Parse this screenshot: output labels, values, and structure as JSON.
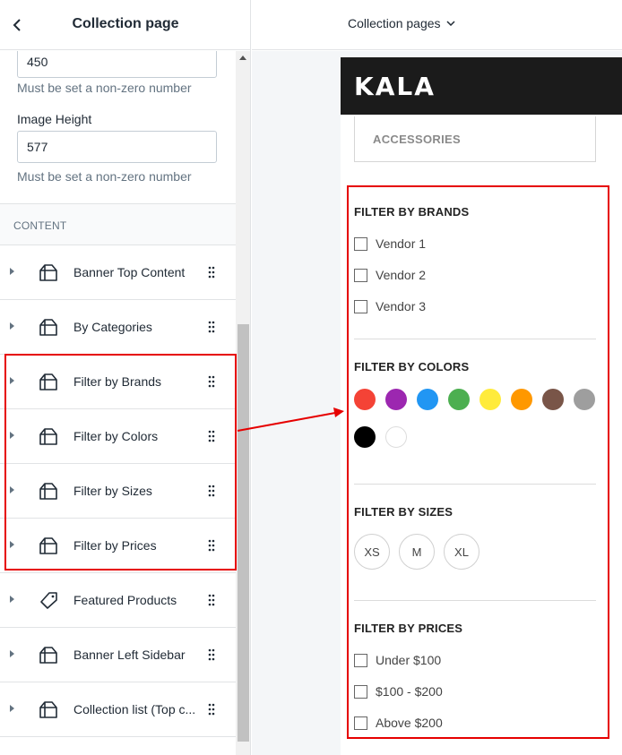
{
  "left_panel": {
    "title": "Collection page",
    "image_width_value": "450",
    "image_width_help": "Must be set a non-zero number",
    "image_height_label": "Image Height",
    "image_height_value": "577",
    "image_height_help": "Must be set a non-zero number",
    "content_section_label": "CONTENT",
    "items": [
      {
        "label": "Banner Top Content",
        "icon": "section-icon"
      },
      {
        "label": "By Categories",
        "icon": "section-icon"
      },
      {
        "label": "Filter by Brands",
        "icon": "section-icon"
      },
      {
        "label": "Filter by Colors",
        "icon": "section-icon"
      },
      {
        "label": "Filter by Sizes",
        "icon": "section-icon"
      },
      {
        "label": "Filter by Prices",
        "icon": "section-icon"
      },
      {
        "label": "Featured Products",
        "icon": "tag-icon"
      },
      {
        "label": "Banner Left Sidebar",
        "icon": "section-icon"
      },
      {
        "label": "Collection list (Top c...",
        "icon": "section-icon"
      }
    ]
  },
  "preview": {
    "page_selector": "Collection pages",
    "logo": "KALA",
    "accessories": "ACCESSORIES",
    "brands": {
      "title": "FILTER BY BRANDS",
      "options": [
        "Vendor 1",
        "Vendor 2",
        "Vendor 3"
      ]
    },
    "colors": {
      "title": "FILTER BY COLORS",
      "swatches": [
        "#f44336",
        "#9c27b0",
        "#2196f3",
        "#4caf50",
        "#ffeb3b",
        "#ff9800",
        "#795548",
        "#9e9e9e",
        "#000000",
        "#ffffff"
      ]
    },
    "sizes": {
      "title": "FILTER BY SIZES",
      "options": [
        "XS",
        "M",
        "XL"
      ]
    },
    "prices": {
      "title": "FILTER BY PRICES",
      "options": [
        "Under $100",
        "$100 - $200",
        "Above $200"
      ]
    }
  },
  "annotation_color": "#e60000"
}
